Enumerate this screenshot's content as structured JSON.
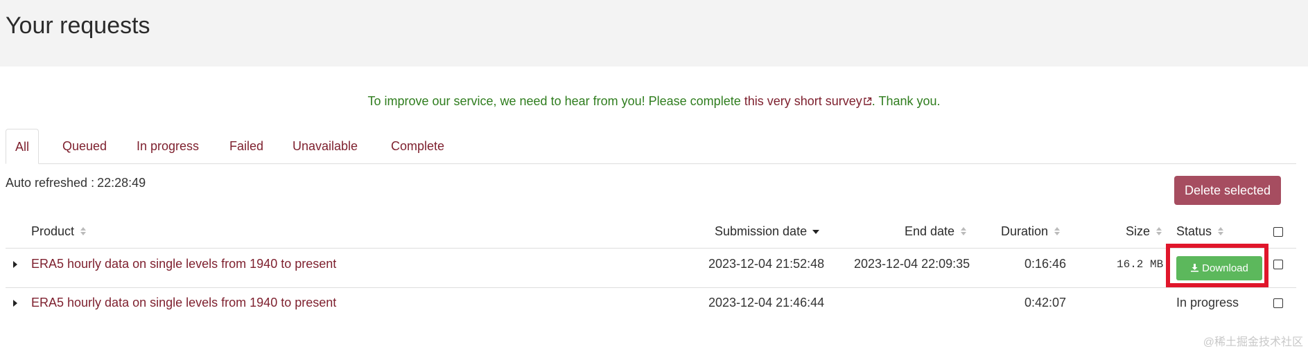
{
  "page": {
    "title": "Your requests"
  },
  "survey": {
    "prefix": "To improve our service, we need to hear from you! Please complete",
    "link_text": "this very short survey",
    "suffix": ". Thank you."
  },
  "tabs": [
    {
      "label": "All",
      "active": true
    },
    {
      "label": "Queued"
    },
    {
      "label": "In progress"
    },
    {
      "label": "Failed"
    },
    {
      "label": "Unavailable"
    },
    {
      "label": "Complete"
    }
  ],
  "refresh": {
    "label": "Auto refreshed :",
    "time": "22:28:49"
  },
  "actions": {
    "delete_selected": "Delete selected"
  },
  "table": {
    "columns": {
      "product": "Product",
      "submission_date": "Submission date",
      "end_date": "End date",
      "duration": "Duration",
      "size": "Size",
      "status": "Status"
    },
    "rows": [
      {
        "product": "ERA5 hourly data on single levels from 1940 to present",
        "submission_date": "2023-12-04 21:52:48",
        "end_date": "2023-12-04 22:09:35",
        "duration": "0:16:46",
        "size": "16.2 MB",
        "status_button": "Download"
      },
      {
        "product": "ERA5 hourly data on single levels from 1940 to present",
        "submission_date": "2023-12-04 21:46:44",
        "end_date": "",
        "duration": "0:42:07",
        "size": "",
        "status": "In progress"
      }
    ]
  },
  "watermark": "@稀土掘金技术社区",
  "colors": {
    "header_bg": "#f3f3f3",
    "link": "#7d1f2d",
    "survey_text": "#2f7d1e",
    "delete_button": "#a64d60",
    "download_button": "#5cb85c",
    "highlight": "#e0162b"
  },
  "icons": {
    "external_link": "external-link-icon",
    "sort": "sort-icon",
    "sort_desc": "sort-desc-icon",
    "expand": "caret-right-icon",
    "download": "download-icon",
    "checkbox": "checkbox-icon"
  }
}
